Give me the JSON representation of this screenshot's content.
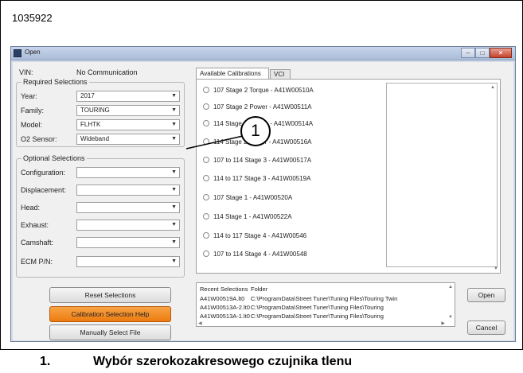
{
  "figure_id": "1035922",
  "window": {
    "title": "Open"
  },
  "vin": {
    "label": "VIN:",
    "value": "No Communication"
  },
  "required": {
    "title": "Required Selections",
    "fields": [
      {
        "label": "Year:",
        "value": "2017"
      },
      {
        "label": "Family:",
        "value": "TOURING"
      },
      {
        "label": "Model:",
        "value": "FLHTK"
      },
      {
        "label": "O2 Sensor:",
        "value": "Wideband"
      }
    ]
  },
  "optional": {
    "title": "Optional Selections",
    "fields": [
      {
        "label": "Configuration:",
        "value": ""
      },
      {
        "label": "Displacement:",
        "value": ""
      },
      {
        "label": "Head:",
        "value": ""
      },
      {
        "label": "Exhaust:",
        "value": ""
      },
      {
        "label": "Camshaft:",
        "value": ""
      },
      {
        "label": "ECM P/N:",
        "value": ""
      }
    ]
  },
  "buttons": {
    "reset": "Reset Selections",
    "help": "Calibration Selection Help",
    "manual": "Manually Select File",
    "open": "Open",
    "cancel": "Cancel"
  },
  "tabs": [
    "Available Calibrations",
    "VCI"
  ],
  "calibrations": [
    "107 Stage 2 Torque - A41W00510A",
    "107 Stage 2 Power - A41W00511A",
    "114 Stage 2 Torque - A41W00514A",
    "114 Stage 2 Power - A41W00516A",
    "107 to 114 Stage 3 - A41W00517A",
    "114 to 117 Stage 3 - A41W00519A",
    "107 Stage 1 - A41W00520A",
    "114 Stage 1 - A41W00522A",
    "114 to 117 Stage 4 - A41W00546",
    "107 to 114 Stage 4 - A41W00548"
  ],
  "recent": {
    "headers": [
      "Recent Selections",
      "Folder"
    ],
    "rows": [
      [
        "A41W00519A.lt0",
        "C:\\ProgramData\\Street Tuner\\Tuning Files\\Touring Twin"
      ],
      [
        "A41W00513A-2.lt0",
        "C:\\ProgramData\\Street Tuner\\Tuning Files\\Touring"
      ],
      [
        "A41W00513A-1.lt0",
        "C:\\ProgramData\\Street Tuner\\Tuning Files\\Touring"
      ]
    ]
  },
  "callout": {
    "number": "1"
  },
  "caption": {
    "number": "1.",
    "text": "Wybór szerokozakresowego czujnika tlenu"
  }
}
